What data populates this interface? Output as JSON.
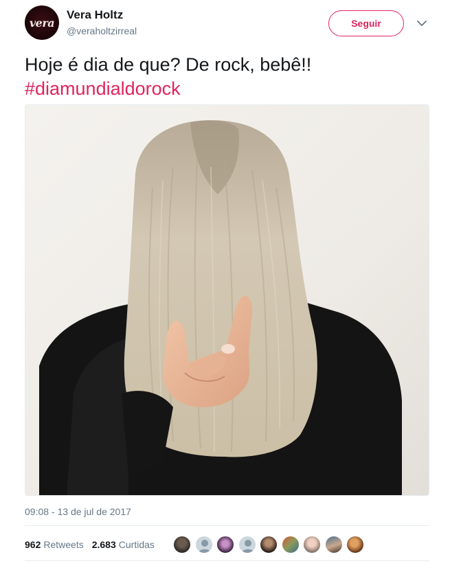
{
  "author": {
    "name": "Vera Holtz",
    "handle": "@veraholtzirreal",
    "avatar_logo": "vera"
  },
  "actions": {
    "follow_label": "Seguir",
    "menu_icon": "chevron-down-icon"
  },
  "tweet": {
    "text": "Hoje é dia de que? De rock, bebê!!",
    "hashtag": "#diamundialdorock",
    "timestamp": "09:08 - 13 de jul de 2017"
  },
  "stats": {
    "retweets_count": "962",
    "retweets_label": "Retweets",
    "likes_count": "2.683",
    "likes_label": "Curtidas"
  },
  "colors": {
    "accent": "#e0245e",
    "text": "#14171a",
    "muted": "#657786",
    "divider": "#e6ecf0"
  }
}
